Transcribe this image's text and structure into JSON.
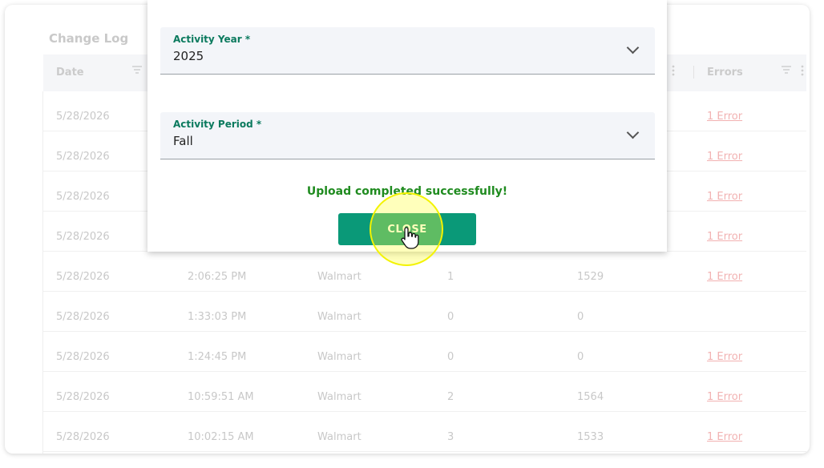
{
  "page": {
    "title": "Change Log"
  },
  "table": {
    "headers": {
      "date": "Date",
      "errors": "Errors"
    },
    "rows": [
      {
        "date": "5/28/2026",
        "time": "",
        "source": "",
        "count1": "",
        "count2": "",
        "errors": "1 Error"
      },
      {
        "date": "5/28/2026",
        "time": "",
        "source": "",
        "count1": "",
        "count2": "",
        "errors": "1 Error"
      },
      {
        "date": "5/28/2026",
        "time": "",
        "source": "",
        "count1": "",
        "count2": "",
        "errors": "1 Error"
      },
      {
        "date": "5/28/2026",
        "time": "",
        "source": "",
        "count1": "",
        "count2": "",
        "errors": "1 Error"
      },
      {
        "date": "5/28/2026",
        "time": "2:06:25 PM",
        "source": "Walmart",
        "count1": "1",
        "count2": "1529",
        "errors": "1 Error"
      },
      {
        "date": "5/28/2026",
        "time": "1:33:03 PM",
        "source": "Walmart",
        "count1": "0",
        "count2": "0",
        "errors": ""
      },
      {
        "date": "5/28/2026",
        "time": "1:24:45 PM",
        "source": "Walmart",
        "count1": "0",
        "count2": "0",
        "errors": "1 Error"
      },
      {
        "date": "5/28/2026",
        "time": "10:59:51 AM",
        "source": "Walmart",
        "count1": "2",
        "count2": "1564",
        "errors": "1 Error"
      },
      {
        "date": "5/28/2026",
        "time": "10:02:15 AM",
        "source": "Walmart",
        "count1": "3",
        "count2": "1533",
        "errors": "1 Error"
      }
    ]
  },
  "modal": {
    "activity_year": {
      "label": "Activity Year *",
      "value": "2025"
    },
    "activity_period": {
      "label": "Activity Period *",
      "value": "Fall"
    },
    "success_message": "Upload completed successfully!",
    "close_label": "CLOSE"
  },
  "colors": {
    "accent": "#0a9978",
    "label_green": "#0b7a5e",
    "success_green": "#1f8b1f",
    "error_link": "#f2b2b2",
    "highlight": "#f3f300"
  },
  "icons": [
    "filter-icon",
    "more-vert-icon",
    "chevron-down-icon",
    "hand-pointer-icon"
  ]
}
